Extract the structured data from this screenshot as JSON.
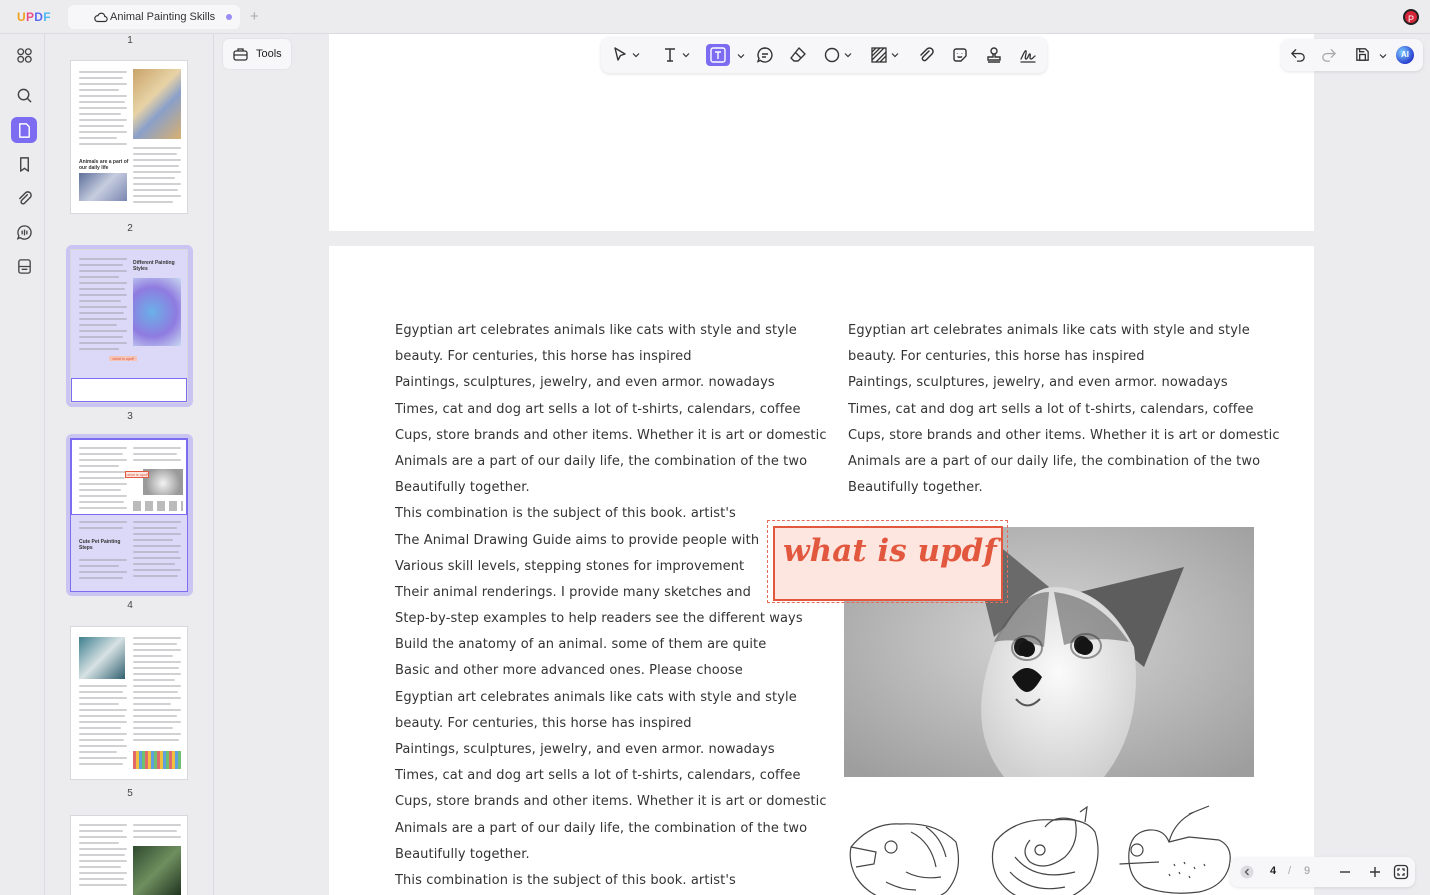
{
  "app": {
    "logo": [
      "U",
      "P",
      "D",
      "F"
    ]
  },
  "tab": {
    "title": "Animal Painting Skills",
    "new_tab": "+"
  },
  "profile": {
    "initial": "P"
  },
  "tools": {
    "label": "Tools"
  },
  "thumbnails": [
    {
      "num": "1"
    },
    {
      "num": "2",
      "heading": "Animals are a part of our daily life"
    },
    {
      "num": "3",
      "heading": "Different Painting Styles",
      "note": "what is updf"
    },
    {
      "num": "4",
      "heading": "Cute Pet Painting Steps",
      "note": "what is updf"
    },
    {
      "num": "5"
    }
  ],
  "document": {
    "left_column": [
      "Egyptian art celebrates animals like cats with style and style",
      "beauty. For centuries, this horse has inspired",
      "Paintings, sculptures, jewelry, and even armor. nowadays",
      "Times, cat and dog art sells a lot of t-shirts, calendars, coffee",
      "Cups, store brands and other items. Whether it is art or domestic",
      "Animals are a part of our daily life, the combination of the two",
      "Beautifully together.",
      "This combination is the subject of this book. artist's",
      "The Animal Drawing Guide aims to provide people with",
      "Various skill levels, stepping stones for improvement",
      "Their animal renderings. I provide many sketches and",
      "Step-by-step examples to help readers see the different ways",
      "Build the anatomy of an animal. some of them are quite",
      "Basic and other more advanced ones. Please choose",
      "Egyptian art celebrates animals like cats with style and style",
      "beauty. For centuries, this horse has inspired",
      "Paintings, sculptures, jewelry, and even armor. nowadays",
      "Times, cat and dog art sells a lot of t-shirts, calendars, coffee",
      "Cups, store brands and other items. Whether it is art or domestic",
      "Animals are a part of our daily life, the combination of the two",
      "Beautifully together.",
      "This combination is the subject of this book. artist's"
    ],
    "right_column": [
      "Egyptian art celebrates animals like cats with style and style",
      "beauty. For centuries, this horse has inspired",
      "Paintings, sculptures, jewelry, and even armor. nowadays",
      "Times, cat and dog art sells a lot of t-shirts, calendars, coffee",
      "Cups, store brands and other items. Whether it is art or domestic",
      "Animals are a part of our daily life, the combination of the two",
      "Beautifully together."
    ],
    "annotation": "what is updf"
  },
  "pager": {
    "current": "4",
    "separator": "/",
    "total": "9"
  },
  "colors": {
    "accent": "#7b6cf2",
    "annotation": "#e2583f",
    "annotation_fill": "#fde6df"
  }
}
